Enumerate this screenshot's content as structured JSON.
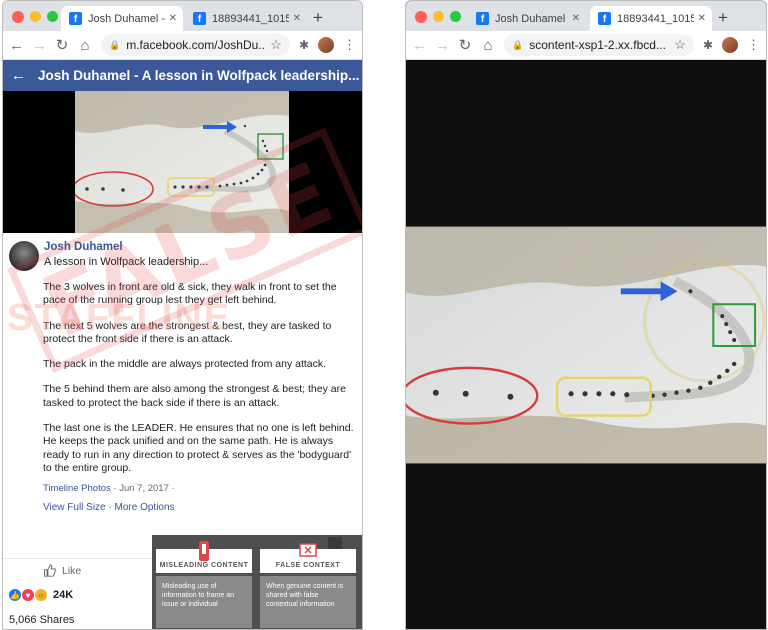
{
  "left_window": {
    "tabs": [
      {
        "title": "Josh Duhamel - A",
        "close": "✕",
        "active": true
      },
      {
        "title": "18893441_10154",
        "close": "✕",
        "active": false
      }
    ],
    "new_tab": "+",
    "url": "m.facebook.com/JoshDu...",
    "icons": {
      "back": "←",
      "forward": "→",
      "reload": "↻",
      "home": "⌂",
      "lock": "🔒",
      "star": "☆",
      "extensions": "✱",
      "menu": "⋮"
    },
    "header": {
      "back": "←",
      "title": "Josh Duhamel - A lesson in Wolfpack leadership... Th..."
    },
    "post": {
      "author": "Josh Duhamel",
      "headline": "A lesson in Wolfpack leadership...",
      "paragraphs": [
        "The 3 wolves in front are old & sick, they walk in front to set the pace of the running group lest they get left behind.",
        "The next 5 wolves are the strongest & best, they are tasked to protect the front side if there is an attack.",
        "The pack in the middle are always protected from any attack.",
        "The 5 behind them are also among the strongest & best; they are tasked to protect the back side if there is an attack.",
        "The last one is the LEADER. He ensures that no one is left behind. He keeps the pack unified and on the same path. He is always ready to run in any direction to protect & serves as the 'bodyguard' to the entire group."
      ],
      "source": "Timeline Photos",
      "sep": " · ",
      "date": "Jun 7, 2017",
      "date_suffix": " · ",
      "view_full": "View Full Size",
      "link_sep": " · ",
      "more_options": "More Options"
    },
    "stamp": "FALSE",
    "watermark": "STAFFLINE",
    "like_label": "Like",
    "reaction_count": "24K",
    "shares": "5,066 Shares",
    "legend": {
      "cards": [
        {
          "title": "MISLEADING CONTENT",
          "body": "Misleading use of information to frame an issue or individual"
        },
        {
          "title": "FALSE CONTEXT",
          "body": "When genuine content is shared with false contextual information"
        }
      ]
    }
  },
  "right_window": {
    "tabs": [
      {
        "title": "Josh Duhamel - A",
        "close": "✕",
        "active": false
      },
      {
        "title": "18893441_10154",
        "close": "✕",
        "active": true
      }
    ],
    "new_tab": "+",
    "url": "scontent-xsp1-2.xx.fbcd...",
    "icons": {
      "back": "←",
      "forward": "→",
      "reload": "↻",
      "home": "⌂",
      "lock": "🔒",
      "star": "☆",
      "extensions": "✱",
      "menu": "⋮"
    }
  },
  "colors": {
    "facebook_blue": "#3b5998",
    "link": "#385898",
    "circle_red": "#d63c3c",
    "box_yellow": "#e8d36a",
    "box_green": "#2f9a3a",
    "arrow_blue": "#2f62d6"
  }
}
